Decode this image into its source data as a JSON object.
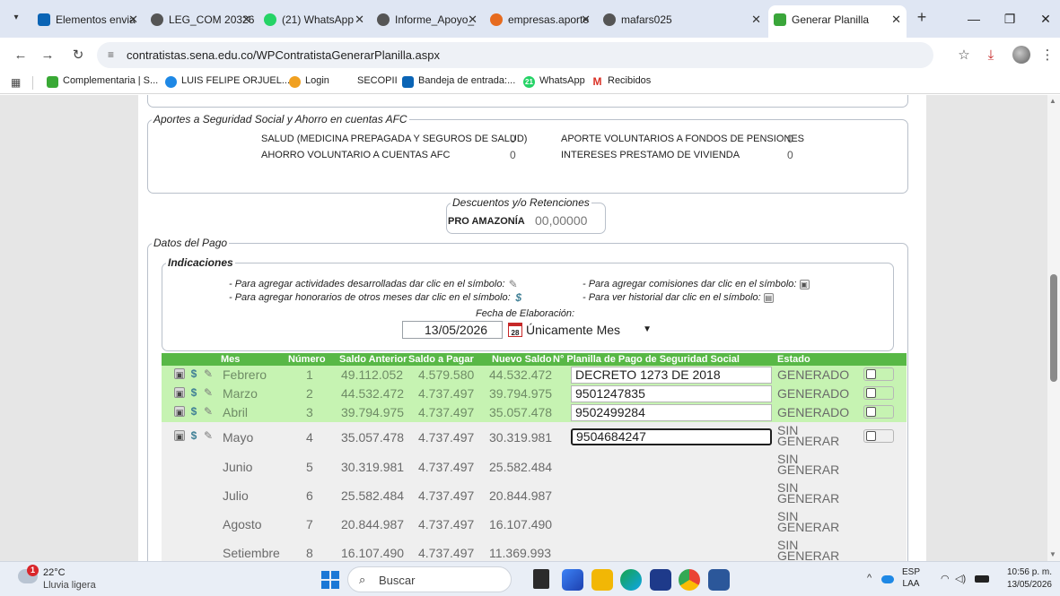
{
  "browser": {
    "tabs": [
      {
        "label": "Elementos envia",
        "fav_color": "#0a64b5"
      },
      {
        "label": "LEG_COM 20326",
        "fav_color": "#555555"
      },
      {
        "label": "(21) WhatsApp",
        "fav_color": "#25d366"
      },
      {
        "label": "Informe_Apoyo_",
        "fav_color": "#555555"
      },
      {
        "label": "empresas.aporte",
        "fav_color": "#e66b1f"
      },
      {
        "label": "mafars025",
        "fav_color": "#555555"
      },
      {
        "label": "Generar Planilla",
        "fav_color": "#3aa63a"
      }
    ],
    "url_site_icon": "≡",
    "url": "contratistas.sena.edu.co/WPContratistaGenerarPlanilla.aspx",
    "bookmarks": [
      {
        "label": "Complementaria | S...",
        "fav_color": "#39a935"
      },
      {
        "label": "LUIS FELIPE ORJUEL...",
        "fav_color": "#1e88e5"
      },
      {
        "label": "Login",
        "fav_color": "#f0a020"
      },
      {
        "label": "SECOPII",
        "fav_color": ""
      },
      {
        "label": "Bandeja de entrada:...",
        "fav_color": "#0a64b5"
      },
      {
        "label": "WhatsApp",
        "fav_color": "#25d366",
        "badge": "21"
      },
      {
        "label": "Recibidos",
        "fav_color": "",
        "glyph": "M"
      }
    ]
  },
  "page": {
    "aportes": {
      "legend": "Aportes a Seguridad Social y Ahorro en cuentas AFC",
      "items": [
        {
          "label": "SALUD (MEDICINA PREPAGADA Y SEGUROS DE SALUD)",
          "value": "0"
        },
        {
          "label": "AHORRO VOLUNTARIO A CUENTAS AFC",
          "value": "0"
        },
        {
          "label": "APORTE VOLUNTARIOS A FONDOS DE PENSIONES",
          "value": "0"
        },
        {
          "label": "INTERESES PRESTAMO DE VIVIENDA",
          "value": "0"
        }
      ]
    },
    "descuentos": {
      "legend": "Descuentos y/o Retenciones",
      "label": "PRO AMAZONÍA",
      "value": "00,00000"
    },
    "datos_pago": {
      "legend": "Datos del Pago",
      "indicaciones_legend": "Indicaciones",
      "notes": [
        "- Para agregar actividades desarrolladas dar clic en el símbolo:",
        "- Para agregar honorarios de otros meses dar clic en el símbolo:",
        "- Para agregar comisiones dar clic en el símbolo:",
        "- Para ver historial dar clic en el símbolo:"
      ],
      "fecha_label": "Fecha de Elaboración:",
      "fecha_value": "13/05/2026",
      "select_value": "Únicamente Mes"
    },
    "table": {
      "headers": [
        "Mes",
        "Número",
        "Saldo Anterior",
        "Saldo a Pagar",
        "Nuevo Saldo",
        "N° Planilla de Pago de Seguridad Social",
        "Estado"
      ],
      "rows": [
        {
          "mes": "Febrero",
          "numero": "1",
          "saldo_anterior": "49.112.052",
          "saldo_pagar": "4.579.580",
          "nuevo_saldo": "44.532.472",
          "planilla": "DECRETO 1273 DE 2018",
          "estado": "GENERADO"
        },
        {
          "mes": "Marzo",
          "numero": "2",
          "saldo_anterior": "44.532.472",
          "saldo_pagar": "4.737.497",
          "nuevo_saldo": "39.794.975",
          "planilla": "9501247835",
          "estado": "GENERADO"
        },
        {
          "mes": "Abril",
          "numero": "3",
          "saldo_anterior": "39.794.975",
          "saldo_pagar": "4.737.497",
          "nuevo_saldo": "35.057.478",
          "planilla": "9502499284",
          "estado": "GENERADO"
        },
        {
          "mes": "Mayo",
          "numero": "4",
          "saldo_anterior": "35.057.478",
          "saldo_pagar": "4.737.497",
          "nuevo_saldo": "30.319.981",
          "planilla": "9504684247",
          "estado_1": "SIN",
          "estado_2": "GENERAR"
        },
        {
          "mes": "Junio",
          "numero": "5",
          "saldo_anterior": "30.319.981",
          "saldo_pagar": "4.737.497",
          "nuevo_saldo": "25.582.484",
          "estado_1": "SIN",
          "estado_2": "GENERAR"
        },
        {
          "mes": "Julio",
          "numero": "6",
          "saldo_anterior": "25.582.484",
          "saldo_pagar": "4.737.497",
          "nuevo_saldo": "20.844.987",
          "estado_1": "SIN",
          "estado_2": "GENERAR"
        },
        {
          "mes": "Agosto",
          "numero": "7",
          "saldo_anterior": "20.844.987",
          "saldo_pagar": "4.737.497",
          "nuevo_saldo": "16.107.490",
          "estado_1": "SIN",
          "estado_2": "GENERAR"
        },
        {
          "mes": "Setiembre",
          "numero": "8",
          "saldo_anterior": "16.107.490",
          "saldo_pagar": "4.737.497",
          "nuevo_saldo": "11.369.993",
          "estado_1": "SIN",
          "estado_2": "GENERAR"
        }
      ]
    }
  },
  "taskbar": {
    "weather_badge": "1",
    "temp": "22°C",
    "desc": "Lluvia ligera",
    "search_placeholder": "Buscar",
    "lang_1": "ESP",
    "lang_2": "LAA",
    "time": "10:56 p. m.",
    "date": "13/05/2026"
  },
  "colors": {
    "header_green": "#58b846",
    "row_green": "#c6f3b2",
    "row_grey": "#efefef"
  }
}
